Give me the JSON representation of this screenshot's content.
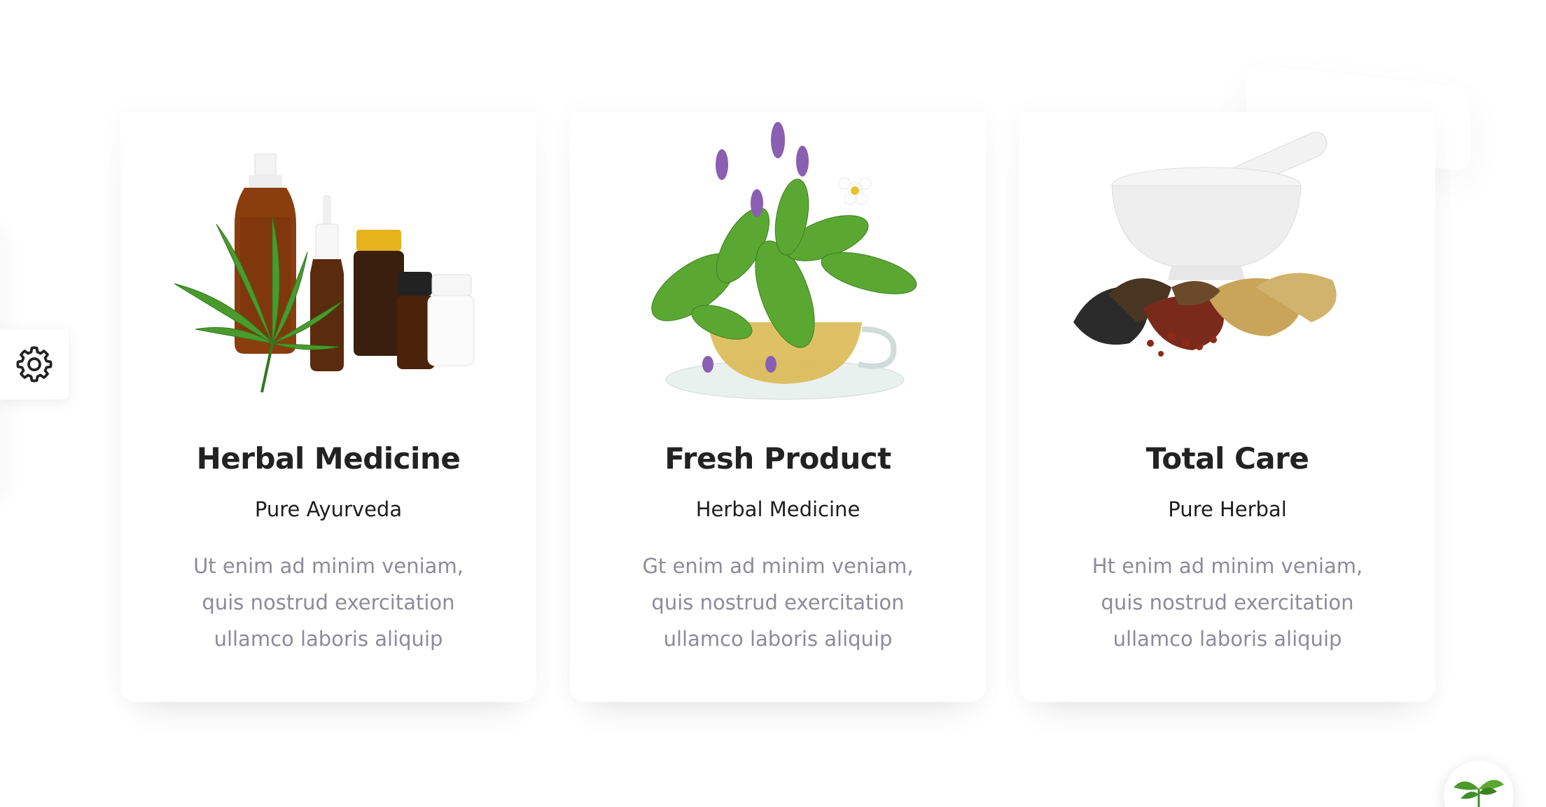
{
  "cards": [
    {
      "title": "Herbal Medicine",
      "subtitle": "Pure Ayurveda",
      "text": "Ut enim ad minim veniam, quis nostrud exercitation ullamco laboris aliquip",
      "image": "herbal-bottles-cannabis-leaf"
    },
    {
      "title": "Fresh Product",
      "subtitle": "Herbal Medicine",
      "text": "Gt enim ad minim veniam, quis nostrud exercitation ullamco laboris aliquip",
      "image": "herbal-tea-cup-with-flowers"
    },
    {
      "title": "Total Care",
      "subtitle": "Pure Herbal",
      "text": "Ht enim ad minim veniam, quis nostrud exercitation ullamco laboris aliquip",
      "image": "mortar-pestle-dried-herbs"
    }
  ],
  "icons": {
    "settings": "gear-icon",
    "fab": "leaf-sprout-icon"
  },
  "colors": {
    "title": "#222222",
    "subtitle": "#1d1d1d",
    "body_text": "#8c8c99",
    "leaf_green": "#3f8f2a"
  }
}
